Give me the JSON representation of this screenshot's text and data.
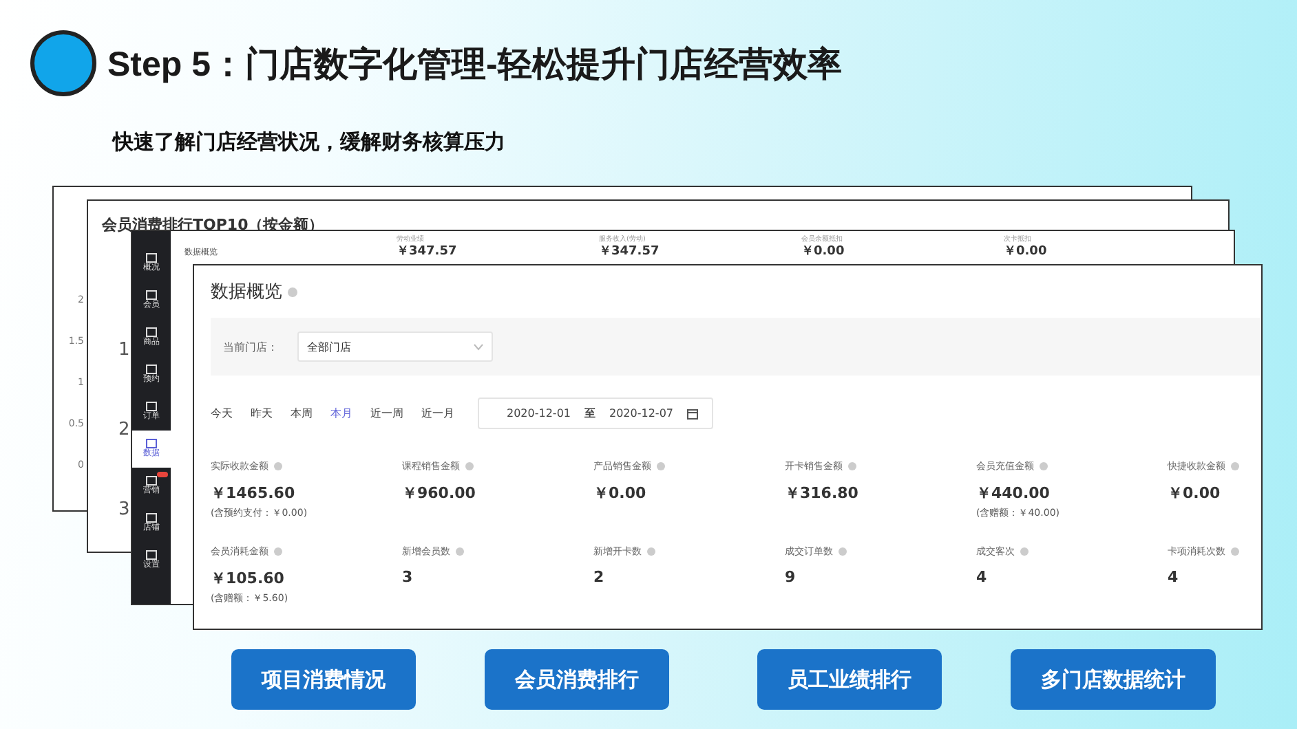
{
  "header": {
    "title": "Step 5：门店数字化管理-轻松提升门店经营效率",
    "subtitle": "快速了解门店经营状况，缓解财务核算压力"
  },
  "chart_window": {
    "y_ticks": [
      "2",
      "1.5",
      "1",
      "0.5",
      "0"
    ]
  },
  "ranking_window": {
    "title": "会员消费排行TOP10（按金额）",
    "ranks": [
      "1",
      "2",
      "3"
    ]
  },
  "nav": [
    {
      "label": "概况",
      "selected": false,
      "badge": false
    },
    {
      "label": "会员",
      "selected": false,
      "badge": false
    },
    {
      "label": "商品",
      "selected": false,
      "badge": false
    },
    {
      "label": "预约",
      "selected": false,
      "badge": false
    },
    {
      "label": "订单",
      "selected": false,
      "badge": false
    },
    {
      "label": "数据",
      "selected": true,
      "badge": false
    },
    {
      "label": "营销",
      "selected": false,
      "badge": true
    },
    {
      "label": "店铺",
      "selected": false,
      "badge": false
    },
    {
      "label": "设置",
      "selected": false,
      "badge": false
    }
  ],
  "overview_window": {
    "title": "数据概览",
    "stats": [
      {
        "label": "劳动业绩",
        "value": "￥347.57"
      },
      {
        "label": "服务收入(劳动)",
        "value": "￥347.57"
      },
      {
        "label": "会员余额抵扣",
        "value": "￥0.00"
      },
      {
        "label": "次卡抵扣",
        "value": "￥0.00"
      }
    ]
  },
  "panel": {
    "title": "数据概览",
    "store_label": "当前门店：",
    "store_value": "全部门店",
    "date_tabs": [
      {
        "label": "今天",
        "selected": false
      },
      {
        "label": "昨天",
        "selected": false
      },
      {
        "label": "本周",
        "selected": false
      },
      {
        "label": "本月",
        "selected": true
      },
      {
        "label": "近一周",
        "selected": false
      },
      {
        "label": "近一月",
        "selected": false
      }
    ],
    "date_start": "2020-12-01",
    "date_separator": "至",
    "date_end": "2020-12-07",
    "stats": [
      {
        "label": "实际收款金额",
        "value": "￥1465.60",
        "note": "(含预约支付：￥0.00)"
      },
      {
        "label": "课程销售金额",
        "value": "￥960.00"
      },
      {
        "label": "产品销售金额",
        "value": "￥0.00"
      },
      {
        "label": "开卡销售金额",
        "value": "￥316.80"
      },
      {
        "label": "会员充值金额",
        "value": "￥440.00",
        "note": "(含赠额：￥40.00)"
      },
      {
        "label": "快捷收款金额",
        "value": "￥0.00"
      },
      {
        "label": "会员消耗金额",
        "value": "￥105.60",
        "note": "(含赠额：￥5.60)"
      },
      {
        "label": "新增会员数",
        "value": "3"
      },
      {
        "label": "新增开卡数",
        "value": "2"
      },
      {
        "label": "成交订单数",
        "value": "9"
      },
      {
        "label": "成交客次",
        "value": "4"
      },
      {
        "label": "卡项消耗次数",
        "value": "4"
      }
    ]
  },
  "buttons": [
    "项目消费情况",
    "会员消费排行",
    "员工业绩排行",
    "多门店数据统计"
  ]
}
